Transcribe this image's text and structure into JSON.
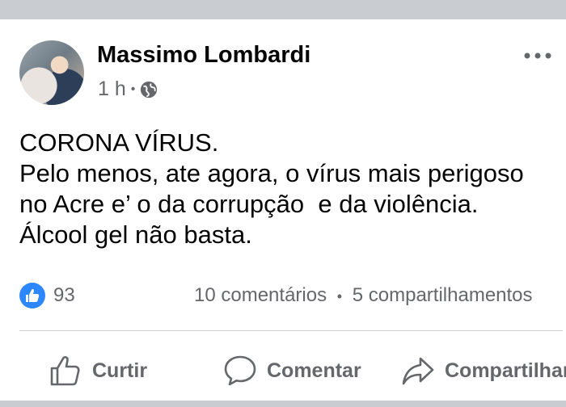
{
  "post": {
    "author": "Massimo Lombardi",
    "time": "1 h",
    "separator": "•",
    "privacy_icon": "globe-icon",
    "more_icon": "more-options-icon",
    "text_lines": [
      "CORONA VÍRUS.",
      "Pelo menos, ate agora, o vírus mais perigoso",
      "no Acre e’ o da corrupção  e da violência.",
      "Álcool gel não basta."
    ]
  },
  "engagement": {
    "reaction_icon": "like-reaction-icon",
    "reaction_count": "93",
    "comments": "10 comentários",
    "dot": "•",
    "shares": "5 compartilhamentos"
  },
  "actions": {
    "like": "Curtir",
    "comment": "Comentar",
    "share": "Compartilhar"
  },
  "colors": {
    "background": "#c9ccd1",
    "card": "#ffffff",
    "text": "#050505",
    "secondary": "#65676b",
    "like_blue": "#2d88ff"
  }
}
